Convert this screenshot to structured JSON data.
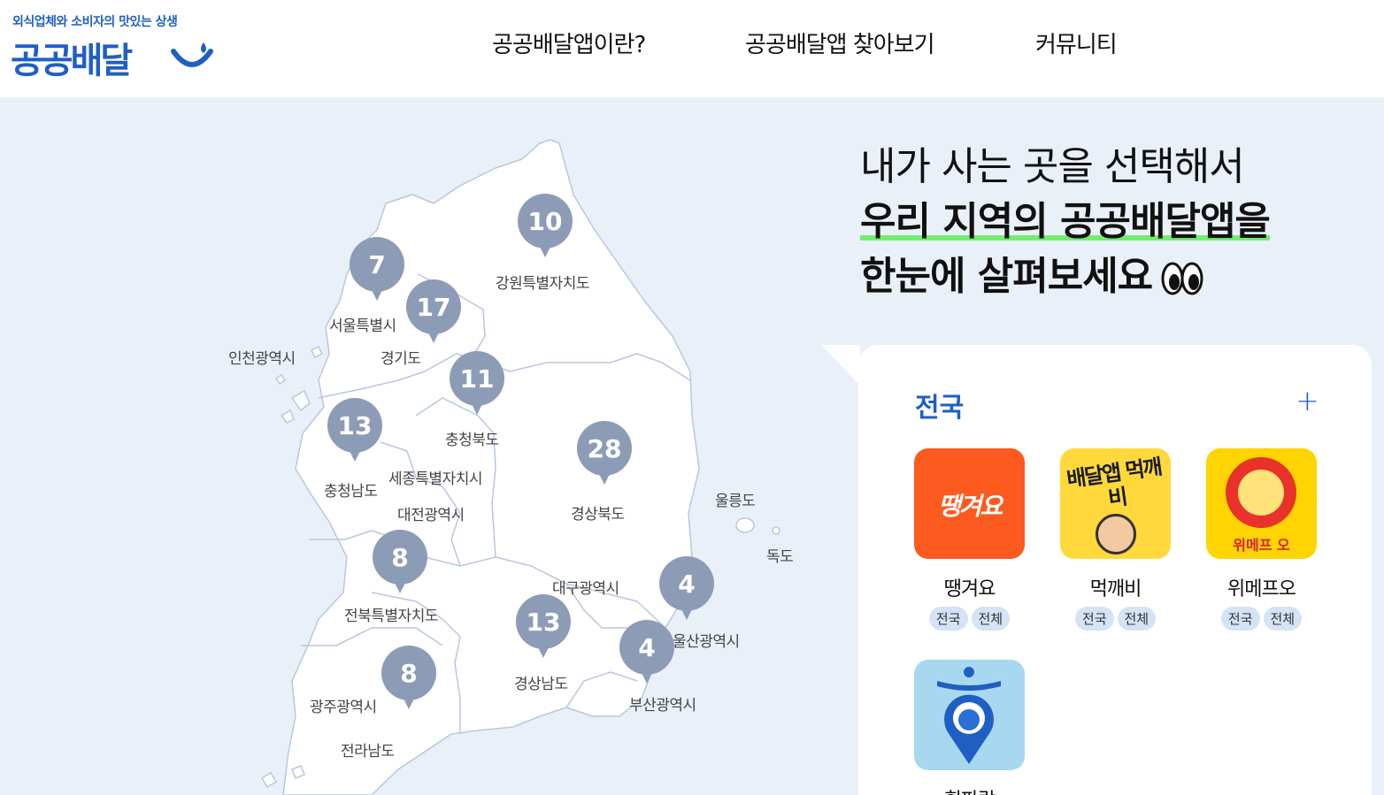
{
  "header": {
    "tagline": "외식업체와 소비자의 맛있는 상생",
    "brand": "공공배달",
    "nav": [
      "공공배달앱이란?",
      "공공배달앱 찾아보기",
      "커뮤니티"
    ]
  },
  "map": {
    "regions": [
      {
        "label": "강원특별자치도",
        "count": "10"
      },
      {
        "label": "서울특별시",
        "count": "7"
      },
      {
        "label": "경기도",
        "count": "17"
      },
      {
        "label": "인천광역시",
        "count": ""
      },
      {
        "label": "충청북도",
        "count": "11"
      },
      {
        "label": "충청남도",
        "count": "13"
      },
      {
        "label": "세종특별자치시",
        "count": ""
      },
      {
        "label": "대전광역시",
        "count": ""
      },
      {
        "label": "경상북도",
        "count": "28"
      },
      {
        "label": "울릉도",
        "count": ""
      },
      {
        "label": "독도",
        "count": ""
      },
      {
        "label": "전북특별자치도",
        "count": "8"
      },
      {
        "label": "대구광역시",
        "count": ""
      },
      {
        "label": "울산광역시",
        "count": "4"
      },
      {
        "label": "경상남도",
        "count": "13"
      },
      {
        "label": "부산광역시",
        "count": "4"
      },
      {
        "label": "광주광역시",
        "count": "8"
      },
      {
        "label": "전라남도",
        "count": ""
      }
    ]
  },
  "headline": {
    "line1": "내가 사는 곳을 선택해서",
    "line2": "우리 지역의 공공배달앱을",
    "line3": "한눈에 살펴보세요"
  },
  "panel": {
    "region_title": "전국",
    "plus": "+",
    "apps": [
      {
        "name": "땡겨요",
        "icon_text": "땡겨요",
        "tags": [
          "전국",
          "전체"
        ],
        "color": "#fc5a1e"
      },
      {
        "name": "먹깨비",
        "icon_text": "배달앱 먹깨비",
        "tags": [
          "전국",
          "전체"
        ],
        "color": "#ffd93b"
      },
      {
        "name": "위메프오",
        "icon_text": "위메프 오",
        "tags": [
          "전국",
          "전체"
        ],
        "color": "#ffd400"
      },
      {
        "name": "휘파람",
        "icon_text": "",
        "tags": [],
        "color": "#a8d8ef"
      }
    ]
  },
  "colors": {
    "brand": "#1f5fc4",
    "pin": "#8d9cb6",
    "background": "#eaf0f8",
    "highlight": "#6ff06b"
  }
}
